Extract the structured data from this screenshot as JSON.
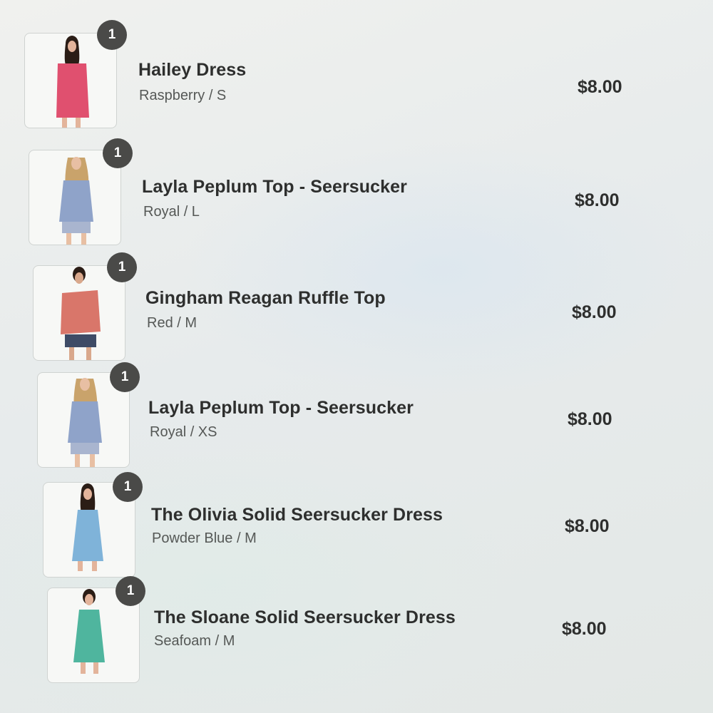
{
  "cart": {
    "items": [
      {
        "quantity": "1",
        "name": "Hailey Dress",
        "variant": "Raspberry / S",
        "price": "$8.00",
        "thumbnail": "model-raspberry-dress"
      },
      {
        "quantity": "1",
        "name": "Layla Peplum Top - Seersucker",
        "variant": "Royal / L",
        "price": "$8.00",
        "thumbnail": "model-blue-peplum-top"
      },
      {
        "quantity": "1",
        "name": "Gingham Reagan Ruffle Top",
        "variant": "Red / M",
        "price": "$8.00",
        "thumbnail": "model-red-ruffle-top"
      },
      {
        "quantity": "1",
        "name": "Layla Peplum Top - Seersucker",
        "variant": "Royal / XS",
        "price": "$8.00",
        "thumbnail": "model-blue-peplum-top"
      },
      {
        "quantity": "1",
        "name": "The Olivia Solid Seersucker Dress",
        "variant": "Powder Blue / M",
        "price": "$8.00",
        "thumbnail": "model-powder-blue-dress"
      },
      {
        "quantity": "1",
        "name": "The Sloane Solid Seersucker Dress",
        "variant": "Seafoam / M",
        "price": "$8.00",
        "thumbnail": "model-seafoam-dress"
      }
    ]
  },
  "colors": {
    "badge": "#4a4a48",
    "text": "#2e2f2e",
    "muted": "#555856",
    "raspberry": "#e0506f",
    "royal": "#8fa3c9",
    "red": "#d9766a",
    "powder_blue": "#7fb3d9",
    "seafoam": "#4fb59e"
  }
}
